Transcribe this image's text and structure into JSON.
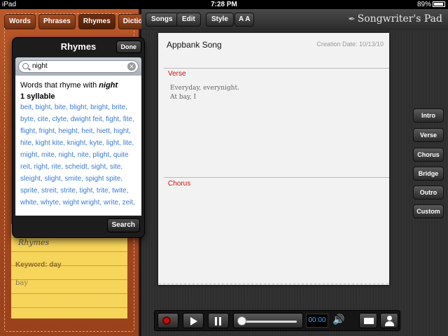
{
  "status_bar": {
    "device": "iPad",
    "time": "7:28 PM",
    "battery": "89%"
  },
  "left_tabs": [
    "Words",
    "Phrases",
    "Rhymes",
    "Dictionary"
  ],
  "popover": {
    "title": "Rhymes",
    "done_label": "Done",
    "search_value": "night",
    "intro": "Words that rhyme with",
    "intro_word": "night",
    "syllable_heading": "1 syllable",
    "words": "beit, bight, bite, blight, bright, brite, byte, cite, clyte, dwight feit, fight, fite, flight, fright, height, heit, hiett, hight, hite, kight kite, knight, kyte, light, lite, might, mite, night, nite, plight, quite reit, right, rite, scheidt, sight, site, sleight, slight, smite, spight spite, sprite, streit, strite, tight, trite, twite, white, whyte, wight wright, write, zeit,",
    "search_label": "Search"
  },
  "notepad": {
    "title": "Rhymes",
    "keyword_label": "Keyword: day",
    "value": "bay"
  },
  "toolbar": {
    "songs": "Songs",
    "edit": "Edit",
    "style": "Style",
    "font_size": "A A",
    "brand": "Songwriter's Pad"
  },
  "song": {
    "title": "Appbank Song",
    "creation_date": "Creation Date: 10/13/10",
    "verse_label": "Verse",
    "verse_lines": [
      "Everyday, everynight.",
      "At bay, I"
    ],
    "chorus_label": "Chorus"
  },
  "section_buttons": [
    "Intro",
    "Verse",
    "Chorus",
    "Bridge",
    "Outro",
    "Custom"
  ],
  "player": {
    "time": "00:00",
    "progress": 0
  }
}
